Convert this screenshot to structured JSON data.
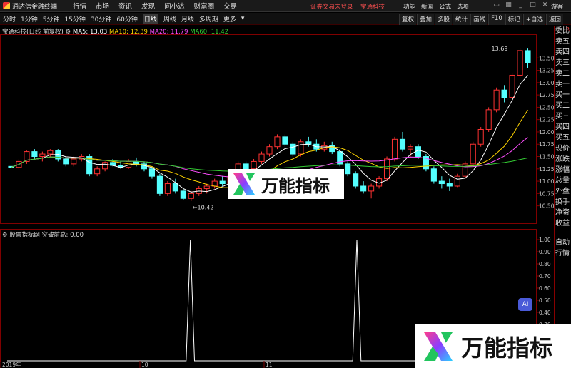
{
  "menubar": {
    "app_title": "通达信金融终端",
    "items": [
      "行情",
      "市场",
      "资讯",
      "发现",
      "问小达",
      "财富圈",
      "交易"
    ],
    "notice": "证券交易未登录",
    "notice_stock": "宝通科技",
    "right_items": [
      "功能",
      "新闻",
      "公式",
      "选项"
    ],
    "guest": "游客"
  },
  "periods": [
    "分时",
    "1分钟",
    "5分钟",
    "15分钟",
    "30分钟",
    "60分钟",
    "日线",
    "周线",
    "月线",
    "多周期",
    "更多"
  ],
  "selected_period": "日线",
  "tools": [
    "复权",
    "叠加",
    "多股",
    "统计",
    "画线",
    "F10",
    "标记",
    "+自选",
    "返回"
  ],
  "stock": {
    "name": "宝通科技(日线 前复权)",
    "ma5": "MA5: 13.03",
    "ma10": "MA10: 12.39",
    "ma20": "MA20: 11.79",
    "ma60": "MA60: 11.42"
  },
  "indicator_info": "股票指标网 突破前高: 0.00",
  "side_panel": {
    "r_label": "R",
    "items": [
      "委比",
      "卖五",
      "卖四",
      "卖三",
      "卖二",
      "卖一",
      "买一",
      "买二",
      "买三",
      "买四",
      "买五",
      "现价",
      "涨跌",
      "涨幅",
      "总量",
      "外盘",
      "换手",
      "净资",
      "收益",
      "",
      "自动",
      "行情"
    ]
  },
  "watermark": "万能指标",
  "ai_badge": "AI",
  "colors": {
    "up": "#ff3232",
    "down": "#54ffff",
    "ma5": "#ffffff",
    "ma10": "#ffd400",
    "ma20": "#ff4dff",
    "ma60": "#33cc33",
    "indicator": "#ffffff",
    "grid": "#800000"
  },
  "chart_data": {
    "type": "candlestick",
    "price_ylim": [
      10.42,
      13.69
    ],
    "price_ticks": [
      "13.50",
      "13.25",
      "13.00",
      "12.75",
      "12.50",
      "12.25",
      "12.00",
      "11.75",
      "11.50",
      "11.25",
      "11.00",
      "10.75",
      "10.50"
    ],
    "high_label": "13.69",
    "low_label": "10.42",
    "x_labels": [
      "2019年",
      "10",
      "11"
    ],
    "indicator_ylim": [
      0,
      1
    ],
    "indicator_ticks": [
      "1.00",
      "0.90",
      "0.80",
      "0.70",
      "0.60",
      "0.50",
      "0.40",
      "0.30",
      "0.20",
      "0.10"
    ],
    "indicator_series": [
      0,
      0,
      0,
      0,
      0,
      0,
      0,
      0,
      0,
      0,
      0,
      0,
      0,
      0,
      0,
      0,
      0,
      0,
      0,
      0,
      0,
      0,
      0,
      0,
      0,
      0,
      0,
      0,
      0,
      0,
      0,
      0,
      0,
      0,
      0,
      0,
      0,
      0,
      0,
      0,
      0,
      0,
      0,
      0,
      1,
      0,
      0,
      0,
      0,
      0,
      0,
      0,
      0,
      0,
      0,
      0,
      0,
      0,
      0,
      0,
      0,
      0,
      0,
      0,
      0,
      0,
      0,
      0,
      0,
      0,
      0,
      0,
      0,
      0,
      0,
      0,
      0,
      0,
      0,
      0,
      0,
      0,
      0,
      0,
      1,
      0,
      0,
      0,
      0,
      0,
      0,
      0,
      0,
      0,
      0,
      0,
      0,
      0,
      0,
      0,
      0,
      0,
      0,
      0,
      0,
      0,
      0,
      0,
      0,
      0,
      0,
      0,
      0,
      0,
      0,
      0,
      0,
      0,
      0,
      0,
      0,
      0,
      0,
      0,
      0,
      0
    ],
    "candles": [
      [
        11.3,
        11.35,
        11.2,
        11.28
      ],
      [
        11.28,
        11.45,
        11.25,
        11.4
      ],
      [
        11.4,
        11.62,
        11.35,
        11.6
      ],
      [
        11.6,
        11.65,
        11.45,
        11.5
      ],
      [
        11.5,
        11.6,
        11.4,
        11.55
      ],
      [
        11.55,
        11.65,
        11.5,
        11.62
      ],
      [
        11.62,
        11.65,
        11.4,
        11.45
      ],
      [
        11.45,
        11.5,
        11.3,
        11.35
      ],
      [
        11.35,
        11.5,
        11.3,
        11.45
      ],
      [
        11.45,
        11.55,
        11.4,
        11.5
      ],
      [
        11.5,
        11.55,
        11.1,
        11.15
      ],
      [
        11.15,
        11.3,
        11.1,
        11.25
      ],
      [
        11.25,
        11.4,
        11.2,
        11.38
      ],
      [
        11.38,
        11.45,
        11.3,
        11.32
      ],
      [
        11.32,
        11.4,
        11.25,
        11.28
      ],
      [
        11.28,
        11.45,
        11.25,
        11.4
      ],
      [
        11.4,
        11.48,
        11.3,
        11.35
      ],
      [
        11.35,
        11.4,
        11.2,
        11.25
      ],
      [
        11.25,
        11.3,
        11.05,
        11.1
      ],
      [
        11.1,
        11.15,
        10.7,
        10.75
      ],
      [
        10.75,
        11.0,
        10.7,
        10.95
      ],
      [
        10.95,
        11.05,
        10.75,
        10.8
      ],
      [
        10.8,
        10.85,
        10.62,
        10.65
      ],
      [
        10.65,
        10.8,
        10.6,
        10.75
      ],
      [
        10.75,
        10.9,
        10.7,
        10.85
      ],
      [
        10.85,
        10.95,
        10.75,
        10.9
      ],
      [
        10.9,
        11.05,
        10.85,
        11.0
      ],
      [
        11.0,
        11.1,
        10.9,
        10.95
      ],
      [
        10.95,
        11.15,
        10.9,
        11.1
      ],
      [
        11.1,
        11.4,
        11.05,
        11.35
      ],
      [
        11.35,
        11.4,
        11.2,
        11.25
      ],
      [
        11.25,
        11.45,
        11.2,
        11.4
      ],
      [
        11.4,
        11.6,
        11.35,
        11.55
      ],
      [
        11.55,
        11.75,
        11.5,
        11.7
      ],
      [
        11.7,
        11.95,
        11.65,
        11.9
      ],
      [
        11.9,
        11.95,
        11.7,
        11.75
      ],
      [
        11.75,
        11.8,
        11.5,
        11.55
      ],
      [
        11.55,
        11.85,
        11.5,
        11.8
      ],
      [
        11.8,
        11.9,
        11.7,
        11.75
      ],
      [
        11.75,
        11.85,
        11.6,
        11.65
      ],
      [
        11.65,
        11.8,
        11.6,
        11.72
      ],
      [
        11.72,
        11.8,
        11.55,
        11.6
      ],
      [
        11.6,
        11.65,
        11.3,
        11.35
      ],
      [
        11.35,
        11.4,
        11.1,
        11.15
      ],
      [
        11.15,
        11.2,
        10.85,
        10.9
      ],
      [
        10.9,
        11.0,
        10.75,
        10.8
      ],
      [
        10.8,
        10.95,
        10.65,
        10.9
      ],
      [
        10.9,
        11.1,
        10.85,
        11.05
      ],
      [
        11.05,
        11.5,
        11.0,
        11.45
      ],
      [
        11.45,
        11.9,
        11.4,
        11.85
      ],
      [
        11.85,
        12.0,
        11.6,
        11.65
      ],
      [
        11.65,
        11.75,
        11.5,
        11.7
      ],
      [
        11.7,
        11.75,
        11.45,
        11.5
      ],
      [
        11.5,
        11.55,
        11.2,
        11.25
      ],
      [
        11.25,
        11.3,
        10.95,
        11.0
      ],
      [
        11.0,
        11.1,
        10.85,
        10.95
      ],
      [
        10.95,
        11.05,
        10.8,
        10.9
      ],
      [
        10.9,
        11.15,
        10.88,
        11.1
      ],
      [
        11.1,
        11.4,
        11.05,
        11.35
      ],
      [
        11.35,
        11.8,
        11.3,
        11.75
      ],
      [
        11.75,
        12.1,
        11.7,
        12.05
      ],
      [
        12.05,
        12.5,
        12.0,
        12.45
      ],
      [
        12.45,
        12.9,
        12.4,
        12.85
      ],
      [
        12.85,
        12.95,
        12.6,
        12.7
      ],
      [
        12.7,
        13.2,
        12.65,
        13.15
      ],
      [
        13.15,
        13.69,
        13.1,
        13.65
      ],
      [
        13.65,
        13.69,
        13.3,
        13.4
      ]
    ]
  }
}
